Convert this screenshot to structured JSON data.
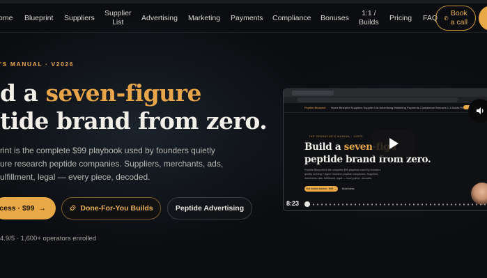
{
  "nav": {
    "items": [
      {
        "label": "Home",
        "lines": [
          "ome"
        ]
      },
      {
        "label": "Blueprint",
        "lines": [
          "Blueprint"
        ]
      },
      {
        "label": "Suppliers",
        "lines": [
          "Suppliers"
        ]
      },
      {
        "label": "Supplier List",
        "lines": [
          "Supplier",
          "List"
        ]
      },
      {
        "label": "Advertising",
        "lines": [
          "Advertising"
        ]
      },
      {
        "label": "Marketing",
        "lines": [
          "Marketing"
        ]
      },
      {
        "label": "Payments",
        "lines": [
          "Payments"
        ]
      },
      {
        "label": "Compliance",
        "lines": [
          "Compliance"
        ]
      },
      {
        "label": "Bonuses",
        "lines": [
          "Bonuses"
        ]
      },
      {
        "label": "1:1 / Builds",
        "lines": [
          "1:1 /",
          "Builds"
        ]
      },
      {
        "label": "Pricing",
        "lines": [
          "Pricing"
        ]
      },
      {
        "label": "FAQ",
        "lines": [
          "FAQ"
        ]
      }
    ],
    "book_call": [
      "Book",
      "a call"
    ],
    "phone_icon": "phone-icon"
  },
  "hero": {
    "eyebrow": "'S MANUAL · V2026",
    "title_line1_pre": "d a ",
    "title_line1_gold": "seven-figure",
    "title_line2": "tide brand from zero.",
    "subtitle_lines": [
      "rint is the complete $99 playbook used by founders quietly",
      "ure research peptide companies. Suppliers, merchants, ads,",
      "ulfillment, legal — every piece, decoded."
    ],
    "primary_button": "ccess · $99",
    "primary_arrow": "→",
    "done_for_you_button": "Done-For-You Builds",
    "rocket_icon": "rocket-icon",
    "advertising_button": "Peptide Advertising",
    "rating": "4.9/5 · 1,600+ operators enrolled"
  },
  "video": {
    "time": "8:23",
    "mini_logo": "Peptide Blueprint",
    "mini_nav": "Home  Blueprint  Suppliers  Supplier List  Advertising  Marketing  Payments  Compliance  Bonuses  1:1 Builds  Pricing  FAQ",
    "mini_eyebrow": "THE OPERATOR'S MANUAL · V2026",
    "mini_title_line1_pre": "Build a ",
    "mini_title_line1_gold": "seven-figu",
    "mini_title_line2": "peptide brand from zero.",
    "mini_sub": [
      "Peptide Blueprint is the complete $99 playbook used by founders",
      "quietly running 7-figure research peptide companies. Suppliers,",
      "merchants, ads, fulfillment, legal — every piece, decoded."
    ],
    "mini_btn1": "Get instant access · $99 →",
    "mini_btn2": "Build ideas",
    "play_icon": "play-icon",
    "speaker_icon": "speaker-icon"
  }
}
